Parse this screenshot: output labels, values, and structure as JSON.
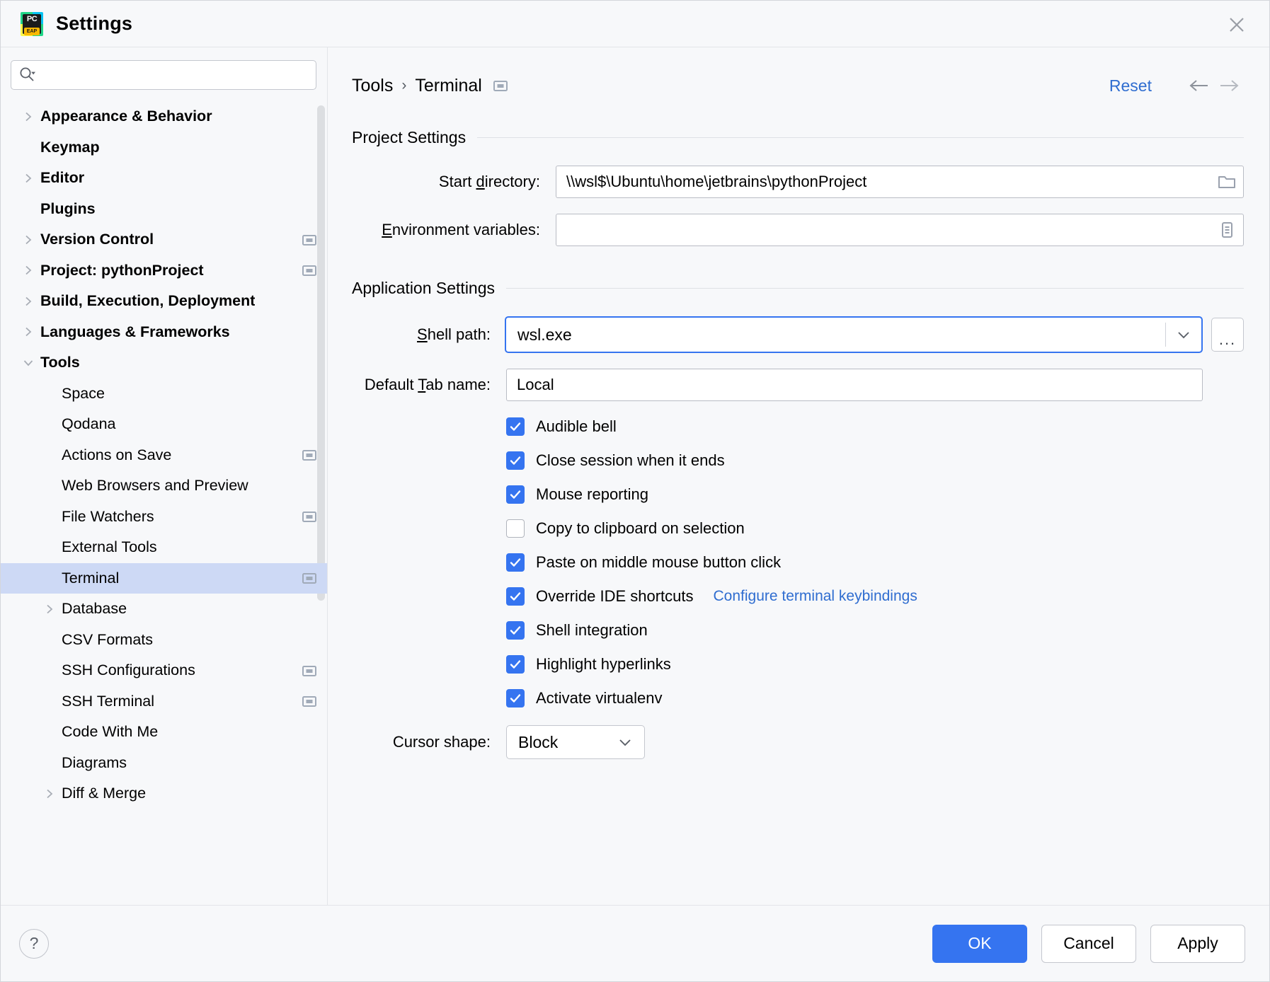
{
  "window": {
    "title": "Settings",
    "app_icon": "pycharm-eap-icon",
    "close_icon": "close-icon"
  },
  "search": {
    "value": "",
    "placeholder": "",
    "icon": "search-icon"
  },
  "sidebar": {
    "scope_badge_icon": "project-scope-icon",
    "items": [
      {
        "label": "Appearance & Behavior",
        "level": 0,
        "arrow": "collapsed",
        "selected": false,
        "badge": false
      },
      {
        "label": "Keymap",
        "level": 0,
        "arrow": "none",
        "selected": false,
        "badge": false
      },
      {
        "label": "Editor",
        "level": 0,
        "arrow": "collapsed",
        "selected": false,
        "badge": false
      },
      {
        "label": "Plugins",
        "level": 0,
        "arrow": "none",
        "selected": false,
        "badge": false
      },
      {
        "label": "Version Control",
        "level": 0,
        "arrow": "collapsed",
        "selected": false,
        "badge": true
      },
      {
        "label": "Project: pythonProject",
        "level": 0,
        "arrow": "collapsed",
        "selected": false,
        "badge": true
      },
      {
        "label": "Build, Execution, Deployment",
        "level": 0,
        "arrow": "collapsed",
        "selected": false,
        "badge": false
      },
      {
        "label": "Languages & Frameworks",
        "level": 0,
        "arrow": "collapsed",
        "selected": false,
        "badge": false
      },
      {
        "label": "Tools",
        "level": 0,
        "arrow": "expanded",
        "selected": false,
        "badge": false
      },
      {
        "label": "Space",
        "level": 1,
        "arrow": "none",
        "selected": false,
        "badge": false
      },
      {
        "label": "Qodana",
        "level": 1,
        "arrow": "none",
        "selected": false,
        "badge": false
      },
      {
        "label": "Actions on Save",
        "level": 1,
        "arrow": "none",
        "selected": false,
        "badge": true
      },
      {
        "label": "Web Browsers and Preview",
        "level": 1,
        "arrow": "none",
        "selected": false,
        "badge": false
      },
      {
        "label": "File Watchers",
        "level": 1,
        "arrow": "none",
        "selected": false,
        "badge": true
      },
      {
        "label": "External Tools",
        "level": 1,
        "arrow": "none",
        "selected": false,
        "badge": false
      },
      {
        "label": "Terminal",
        "level": 1,
        "arrow": "none",
        "selected": true,
        "badge": true
      },
      {
        "label": "Database",
        "level": 1,
        "arrow": "collapsed",
        "selected": false,
        "badge": false
      },
      {
        "label": "CSV Formats",
        "level": 1,
        "arrow": "none",
        "selected": false,
        "badge": false
      },
      {
        "label": "SSH Configurations",
        "level": 1,
        "arrow": "none",
        "selected": false,
        "badge": true
      },
      {
        "label": "SSH Terminal",
        "level": 1,
        "arrow": "none",
        "selected": false,
        "badge": true
      },
      {
        "label": "Code With Me",
        "level": 1,
        "arrow": "none",
        "selected": false,
        "badge": false
      },
      {
        "label": "Diagrams",
        "level": 1,
        "arrow": "none",
        "selected": false,
        "badge": false
      },
      {
        "label": "Diff & Merge",
        "level": 1,
        "arrow": "collapsed",
        "selected": false,
        "badge": false
      }
    ]
  },
  "header": {
    "breadcrumb_parent": "Tools",
    "breadcrumb_separator": "›",
    "breadcrumb_current": "Terminal",
    "scope_badge_icon": "project-scope-icon",
    "reset_label": "Reset",
    "back_icon": "arrow-left-icon",
    "forward_icon": "arrow-right-icon"
  },
  "project_settings": {
    "title": "Project Settings",
    "start_directory": {
      "label_prefix": "Start ",
      "label_mnemonic": "d",
      "label_suffix": "irectory:",
      "value": "\\\\wsl$\\Ubuntu\\home\\jetbrains\\pythonProject",
      "browse_icon": "folder-icon"
    },
    "environment_variables": {
      "label_prefix": "",
      "label_mnemonic": "E",
      "label_suffix": "nvironment variables:",
      "value": "",
      "browse_icon": "list-edit-icon"
    }
  },
  "application_settings": {
    "title": "Application Settings",
    "shell_path": {
      "label_prefix": "",
      "label_mnemonic": "S",
      "label_suffix": "hell path:",
      "value": "wsl.exe",
      "chevron_icon": "chevron-down-icon",
      "browse_label": "...",
      "focused": true
    },
    "default_tab_name": {
      "label_prefix": "Default ",
      "label_mnemonic": "T",
      "label_suffix": "ab name:",
      "value": "Local"
    },
    "checkboxes": [
      {
        "label": "Audible bell",
        "checked": true,
        "link": null
      },
      {
        "label": "Close session when it ends",
        "checked": true,
        "link": null
      },
      {
        "label": "Mouse reporting",
        "checked": true,
        "link": null
      },
      {
        "label": "Copy to clipboard on selection",
        "checked": false,
        "link": null
      },
      {
        "label": "Paste on middle mouse button click",
        "checked": true,
        "link": null
      },
      {
        "label": "Override IDE shortcuts",
        "checked": true,
        "link": "Configure terminal keybindings"
      },
      {
        "label": "Shell integration",
        "checked": true,
        "link": null
      },
      {
        "label": "Highlight hyperlinks",
        "checked": true,
        "link": null
      },
      {
        "label": "Activate virtualenv",
        "checked": true,
        "link": null
      }
    ],
    "cursor_shape": {
      "label": "Cursor shape:",
      "value": "Block",
      "chevron_icon": "chevron-down-icon"
    }
  },
  "footer": {
    "help_label": "?",
    "ok_label": "OK",
    "cancel_label": "Cancel",
    "apply_label": "Apply"
  },
  "colors": {
    "accent": "#3574f0",
    "link": "#2f6dd0",
    "selection": "#cdd9f5",
    "background": "#f7f8fa",
    "badge": "#a0aab8"
  }
}
